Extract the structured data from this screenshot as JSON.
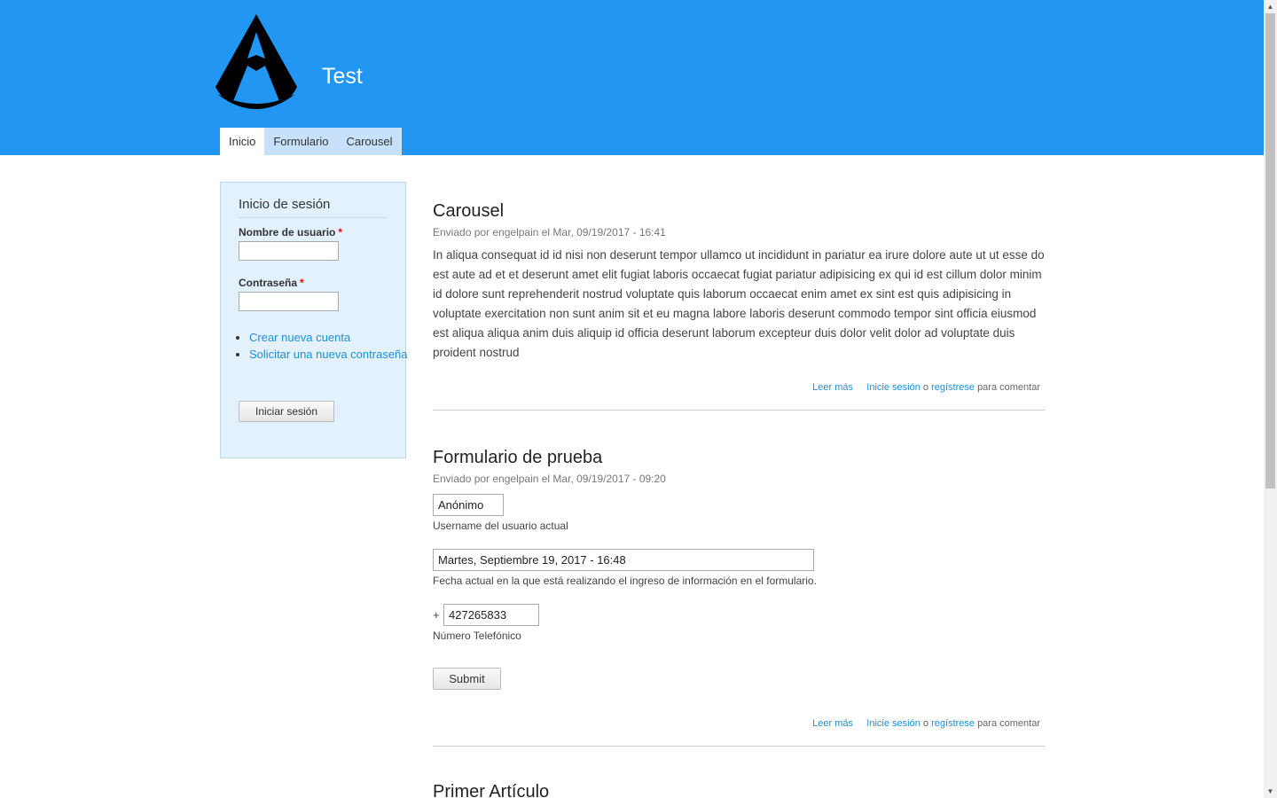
{
  "header": {
    "site_name": "Test",
    "logo_icon": "assassins-creed-logo-icon",
    "bg_color": "#2196f3"
  },
  "nav": {
    "tabs": [
      {
        "label": "Inicio",
        "active": true
      },
      {
        "label": "Formulario",
        "active": false
      },
      {
        "label": "Carousel",
        "active": false
      }
    ]
  },
  "login": {
    "title": "Inicio de sesión",
    "username_label": "Nombre de usuario",
    "password_label": "Contraseña",
    "required_mark": "*",
    "username_value": "",
    "password_value": "",
    "links": [
      "Crear nueva cuenta",
      "Solicitar una nueva contraseña"
    ],
    "submit_label": "Iniciar sesión"
  },
  "articles": [
    {
      "title": "Carousel",
      "submitted": "Enviado por engelpain el Mar, 09/19/2017 - 16:41",
      "body": "In aliqua consequat id id nisi non deserunt tempor ullamco ut incididunt in pariatur ea irure dolore aute ut ut esse do est aute ad et et deserunt amet elit fugiat laboris occaecat fugiat pariatur adipisicing ex qui id est cillum dolor minim id dolore sunt reprehenderit nostrud voluptate quis laborum occaecat enim amet ex sint est quis adipisicing in voluptate exercitation non sunt anim sit et eu magna labore laboris deserunt commodo tempor sint officia eiusmod est aliqua aliqua anim duis aliquip id officia deserunt laborum excepteur duis dolor velit dolor ad voluptate duis proident nostrud",
      "read_more": "Leer más",
      "login_link": "Inicie sesión",
      "or_text": "o",
      "register_link": "regístrese",
      "comment_text": "para comentar"
    },
    {
      "title": "Formulario de prueba",
      "submitted": "Enviado por engelpain el Mar, 09/19/2017 - 09:20",
      "form": {
        "username_value": "Anónimo",
        "username_desc": "Username del usuario actual",
        "date_value": "Martes, Septiembre 19, 2017 - 16:48",
        "date_desc": "Fecha actual en la que está realizando el ingreso de información en el formulario.",
        "phone_prefix": "+",
        "phone_value": "427265833",
        "phone_desc": "Número Telefónico",
        "submit_label": "Submit"
      },
      "read_more": "Leer más",
      "login_link": "Inicie sesión",
      "or_text": "o",
      "register_link": "regístrese",
      "comment_text": "para comentar"
    },
    {
      "title": "Primer Artículo"
    }
  ]
}
